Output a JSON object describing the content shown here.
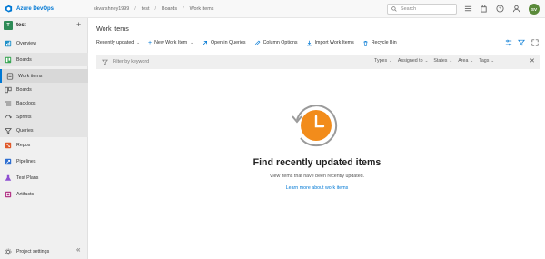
{
  "app": {
    "brand": "Azure DevOps"
  },
  "breadcrumb": [
    "skvarshney1999",
    "test",
    "Boards",
    "Work items"
  ],
  "search": {
    "placeholder": "Search"
  },
  "user": {
    "initials": "SV"
  },
  "sidebar": {
    "project": {
      "badge": "T",
      "name": "test"
    },
    "items": [
      {
        "label": "Overview",
        "icon": "overview-icon"
      },
      {
        "label": "Boards",
        "icon": "boards-icon"
      },
      {
        "label": "Work items",
        "icon": "work-items-icon"
      },
      {
        "label": "Boards",
        "icon": "board-icon"
      },
      {
        "label": "Backlogs",
        "icon": "backlogs-icon"
      },
      {
        "label": "Sprints",
        "icon": "sprints-icon"
      },
      {
        "label": "Queries",
        "icon": "queries-icon"
      },
      {
        "label": "Repos",
        "icon": "repos-icon"
      },
      {
        "label": "Pipelines",
        "icon": "pipelines-icon"
      },
      {
        "label": "Test Plans",
        "icon": "test-plans-icon"
      },
      {
        "label": "Artifacts",
        "icon": "artifacts-icon"
      }
    ],
    "footer": {
      "label": "Project settings"
    }
  },
  "main": {
    "title": "Work items",
    "toolbar": {
      "view": "Recently updated",
      "new": "New Work Item",
      "open": "Open in Queries",
      "columns": "Column Options",
      "import": "Import Work Items",
      "recycle": "Recycle Bin"
    },
    "filter": {
      "placeholder": "Filter by keyword",
      "options": [
        "Types",
        "Assigned to",
        "States",
        "Area",
        "Tags"
      ]
    },
    "empty": {
      "title": "Find recently updated items",
      "subtitle": "View items that have been recently updated.",
      "link": "Learn more about work items"
    }
  },
  "colors": {
    "accent": "#0078d4",
    "orange": "#f28c1b",
    "sidebar": "#f0f0f0"
  }
}
